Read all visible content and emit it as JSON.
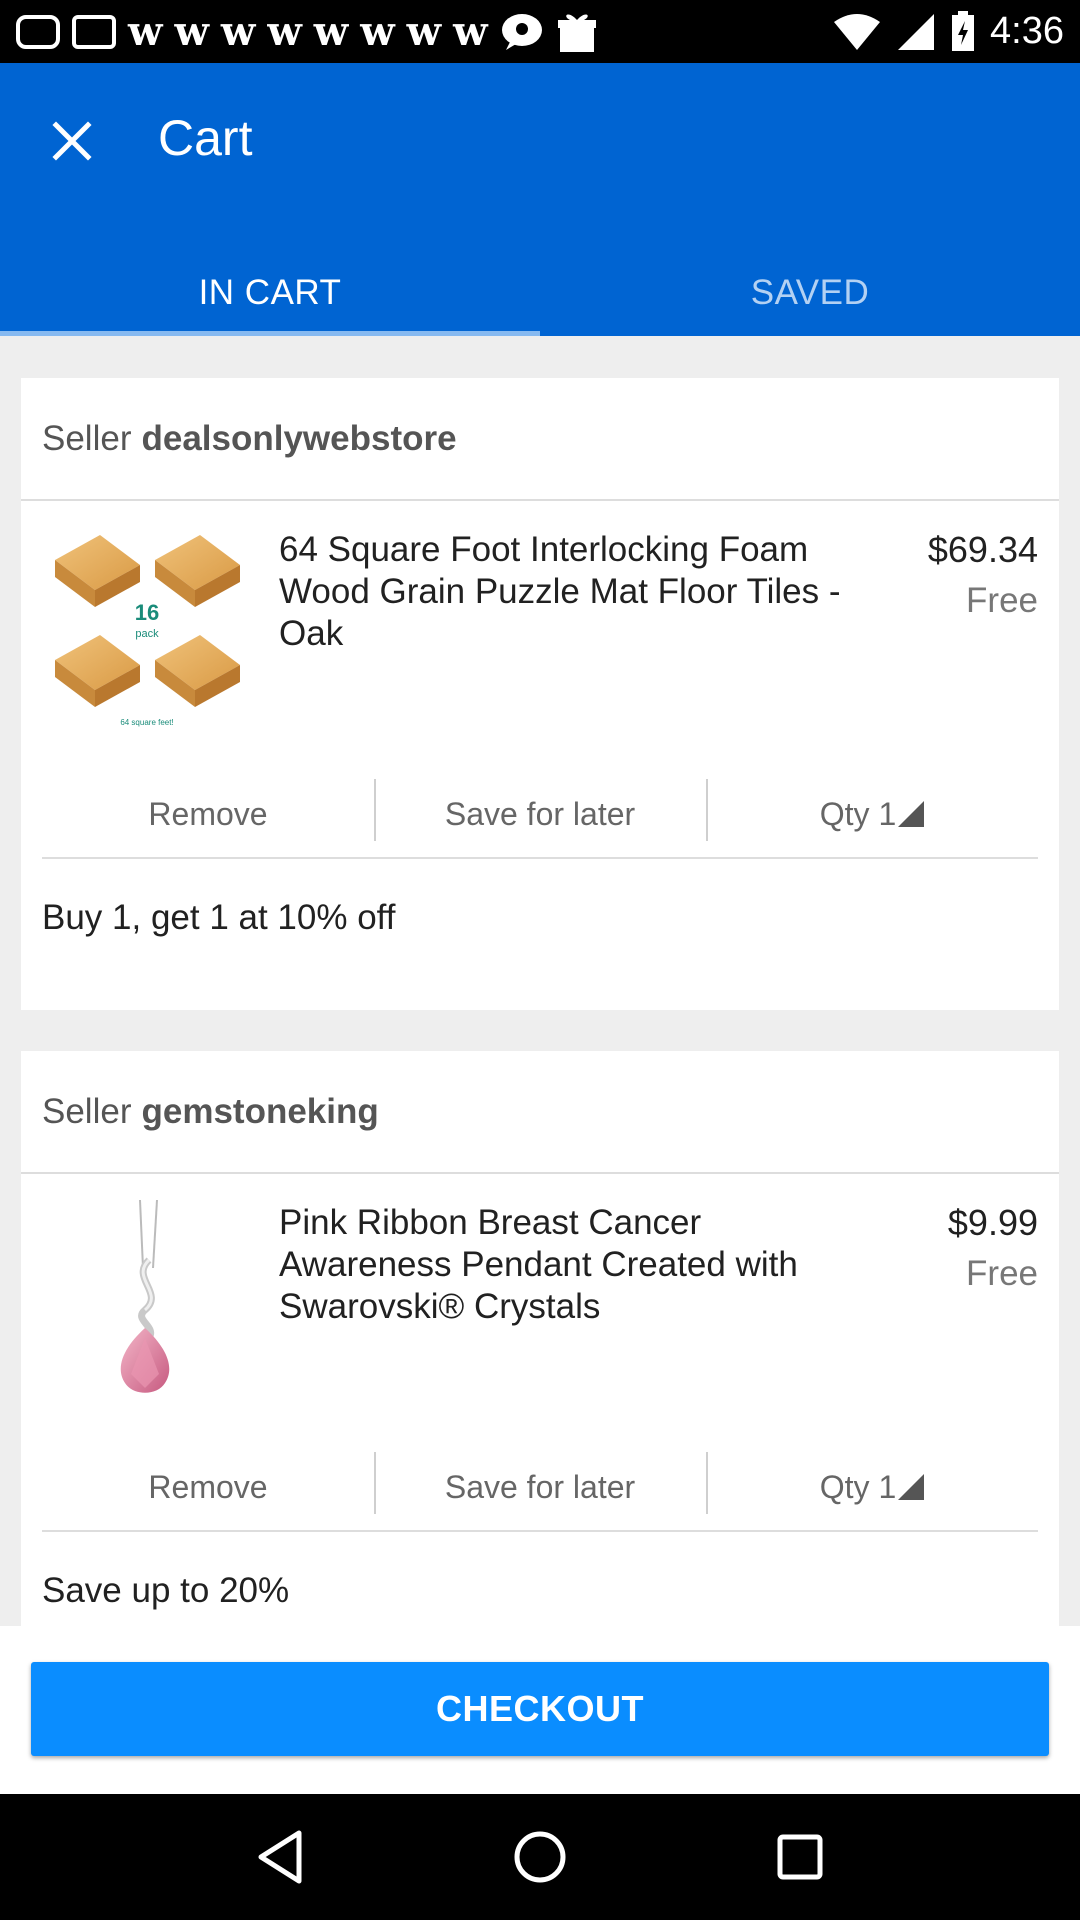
{
  "status_bar": {
    "time": "4:36",
    "icons": [
      "chat-bubble-icon",
      "gmail-icon",
      "w-icon",
      "w-icon",
      "w-icon",
      "w-icon",
      "w-icon",
      "w-icon",
      "w-icon",
      "w-icon",
      "messenger-icon",
      "gift-box-icon",
      "wifi-icon",
      "signal-icon",
      "battery-charging-icon"
    ],
    "w_glyph": "w"
  },
  "header": {
    "title": "Cart",
    "close_icon": "close-icon",
    "color": "#0064d2"
  },
  "tabs": [
    {
      "label": "IN CART",
      "active": true
    },
    {
      "label": "SAVED",
      "active": false
    }
  ],
  "sellers": [
    {
      "prefix": "Seller",
      "name": "dealsonlywebstore",
      "item": {
        "title": "64 Square Foot Interlocking Foam Wood Grain Puzzle Mat Floor Tiles - Oak",
        "price": "$69.34",
        "shipping": "Free",
        "image_badge": "16",
        "image_badge_sub": "pack",
        "image_caption": "64 square feet!"
      },
      "actions": {
        "remove": "Remove",
        "save": "Save for later",
        "qty": "Qty 1"
      },
      "promo": "Buy 1, get 1 at 10% off"
    },
    {
      "prefix": "Seller",
      "name": "gemstoneking",
      "item": {
        "title": "Pink Ribbon Breast Cancer Awareness Pendant Created with Swarovski® Crystals",
        "price": "$9.99",
        "shipping": "Free"
      },
      "actions": {
        "remove": "Remove",
        "save": "Save for later",
        "qty": "Qty 1"
      },
      "promo": "Save up to 20%"
    }
  ],
  "checkout": {
    "label": "CHECKOUT",
    "color": "#0a8dff"
  },
  "nav": {
    "back": "back-triangle-icon",
    "home": "home-circle-icon",
    "recents": "recents-square-icon"
  }
}
